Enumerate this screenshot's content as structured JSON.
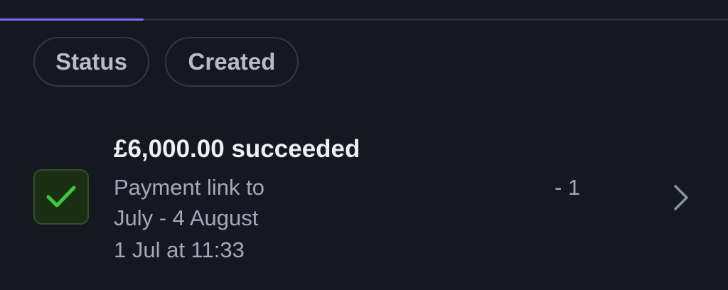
{
  "tabs": {
    "progress_fraction": 0.197
  },
  "filters": {
    "status_label": "Status",
    "created_label": "Created"
  },
  "payment": {
    "amount": "£6,000.00",
    "status": "succeeded",
    "description_start": "Payment link to",
    "description_end": "- 1",
    "description_line2": "July - 4 August",
    "timestamp": "1 Jul at 11:33",
    "status_icon": "check-icon"
  },
  "colors": {
    "background": "#161821",
    "accent": "#7c6cf4",
    "success": "#3ec93a"
  }
}
